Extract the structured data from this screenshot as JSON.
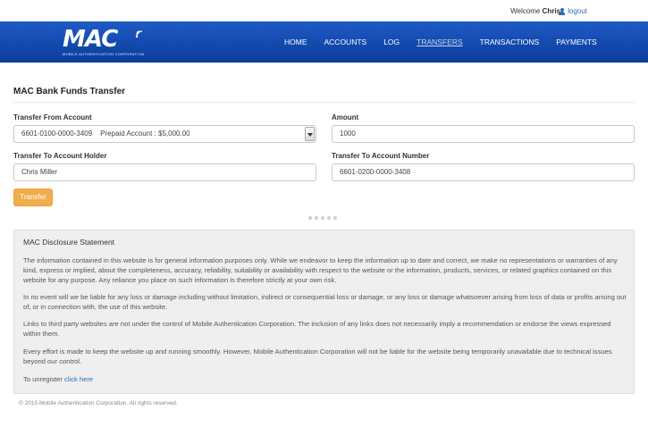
{
  "header": {
    "welcome_prefix": "Welcome",
    "username": "Chris",
    "logout_label": "logout"
  },
  "logo": {
    "mark": "MAC",
    "subtitle": "MOBILE AUTHENTICATION CORPORATION"
  },
  "nav": {
    "items": [
      {
        "label": "HOME"
      },
      {
        "label": "ACCOUNTS"
      },
      {
        "label": "LOG"
      },
      {
        "label": "TRANSFERS",
        "active": true
      },
      {
        "label": "TRANSACTIONS"
      },
      {
        "label": "PAYMENTS"
      }
    ]
  },
  "form": {
    "title": "MAC Bank Funds Transfer",
    "from_label": "Transfer From Account",
    "from_value": "6601-0100-0000-3409    Prepaid Account : $5,000.00",
    "amount_label": "Amount",
    "amount_value": "1000",
    "holder_label": "Transfer To Account Holder",
    "holder_value": "Chris Miller",
    "account_label": "Transfer To Account Number",
    "account_value": "6601-0200-0000-3408",
    "submit_label": "Transfer"
  },
  "disclosure": {
    "heading": "MAC Disclosure Statement",
    "p1": "The information contained in this website is for general information purposes only. While we endeavor to keep the information up to date and correct, we make no representations or warranties of any kind, express or implied, about the completeness, accuracy, reliability, suitability or availability with respect to the website or the information, products, services, or related graphics contained on this website for any purpose. Any reliance you place on such information is therefore strictly at your own risk.",
    "p2": "In no event will we be liable for any loss or damage including without limitation, indirect or consequential loss or damage, or any loss or damage whatsoever arising from loss of data or profits arising out of, or in connection with, the use of this website.",
    "p3": "Links to third party websites are not under the control of Mobile Authentication Corporation. The inclusion of any links does not necessarily imply a recommendation or endorse the views expressed within them.",
    "p4": "Every effort is made to keep the website up and running smoothly. However, Mobile Authentication Corporation will not be liable for the website being temporarily unavailable due to technical issues beyond our control.",
    "unregister_prefix": "To unregister",
    "unregister_link": "click here"
  },
  "footer": {
    "copyright": "© 2015 Mobile Authentication Corporation. All rights reserved."
  },
  "colors": {
    "nav_top": "#1f5bc4",
    "nav_bottom": "#0b3c9c",
    "button": "#f0ad4e",
    "link": "#2a6db5"
  }
}
